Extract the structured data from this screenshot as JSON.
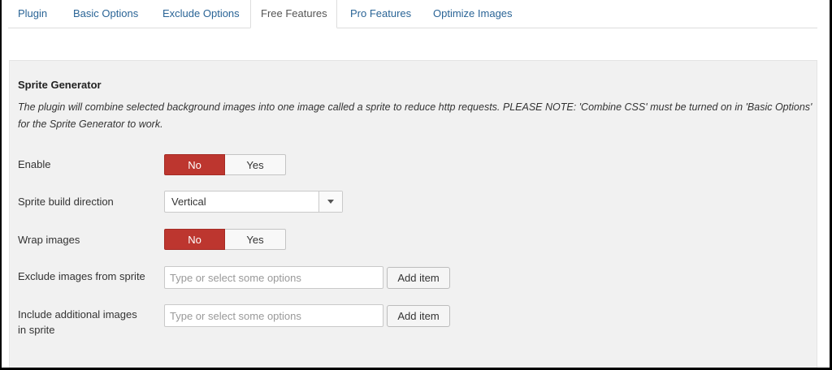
{
  "tabs": [
    {
      "label": "Plugin",
      "active": false
    },
    {
      "label": "Basic Options",
      "active": false
    },
    {
      "label": "Exclude Options",
      "active": false
    },
    {
      "label": "Free Features",
      "active": true
    },
    {
      "label": "Pro Features",
      "active": false
    },
    {
      "label": "Optimize Images",
      "active": false
    }
  ],
  "section": {
    "title": "Sprite Generator",
    "description": "The plugin will combine selected background images into one image called a sprite to reduce http requests. PLEASE NOTE: 'Combine CSS' must be turned on in 'Basic Options' for the Sprite Generator to work."
  },
  "fields": {
    "enable": {
      "label": "Enable",
      "no": "No",
      "yes": "Yes",
      "selected": "No"
    },
    "direction": {
      "label": "Sprite build direction",
      "value": "Vertical"
    },
    "wrap": {
      "label": "Wrap images",
      "no": "No",
      "yes": "Yes",
      "selected": "No"
    },
    "exclude": {
      "label": "Exclude images from sprite",
      "placeholder": "Type or select some options",
      "button": "Add item"
    },
    "include": {
      "label_line1": "Include additional images",
      "label_line2": "in sprite",
      "placeholder": "Type or select some options",
      "button": "Add item"
    }
  },
  "colors": {
    "toggle_active": "#bd362f",
    "tab_link": "#2a6496",
    "panel_bg": "#f1f1f1"
  },
  "icons": {
    "select_caret": "chevron-down-icon"
  }
}
